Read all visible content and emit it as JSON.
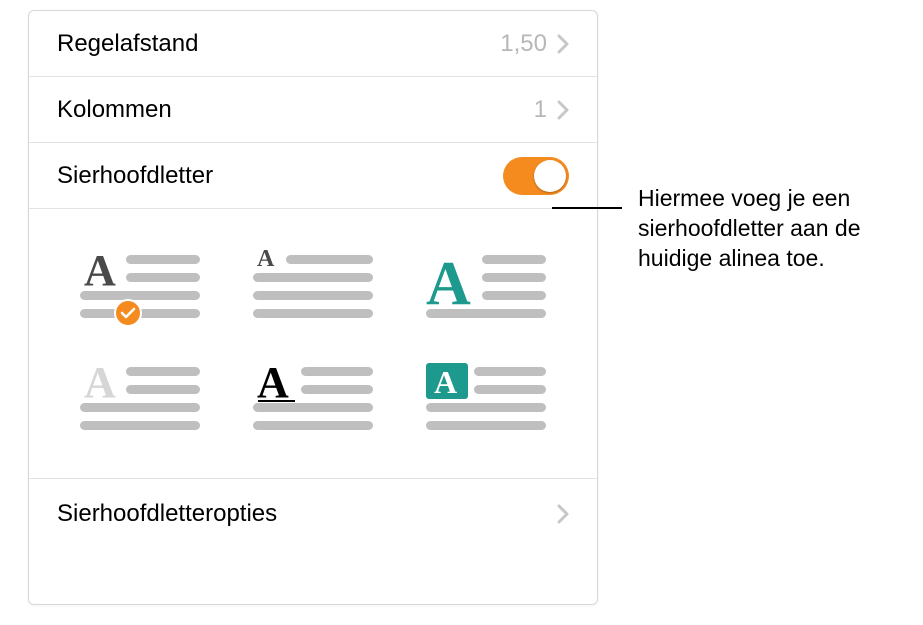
{
  "rows": {
    "line_spacing": {
      "label": "Regelafstand",
      "value": "1,50"
    },
    "columns": {
      "label": "Kolommen",
      "value": "1"
    },
    "drop_cap": {
      "label": "Sierhoofdletter"
    },
    "options": {
      "label": "Sierhoofdletteropties"
    }
  },
  "styles": [
    {
      "id": "style-1",
      "selected": true
    },
    {
      "id": "style-2",
      "selected": false
    },
    {
      "id": "style-3",
      "selected": false
    },
    {
      "id": "style-4",
      "selected": false
    },
    {
      "id": "style-5",
      "selected": false
    },
    {
      "id": "style-6",
      "selected": false
    }
  ],
  "callout": "Hiermee voeg je een sierhoofdletter aan de huidige alinea toe.",
  "colors": {
    "accent": "#f58b1f",
    "teal": "#1e998d",
    "line": "#bfbfbf",
    "light": "#d8d8d8"
  }
}
